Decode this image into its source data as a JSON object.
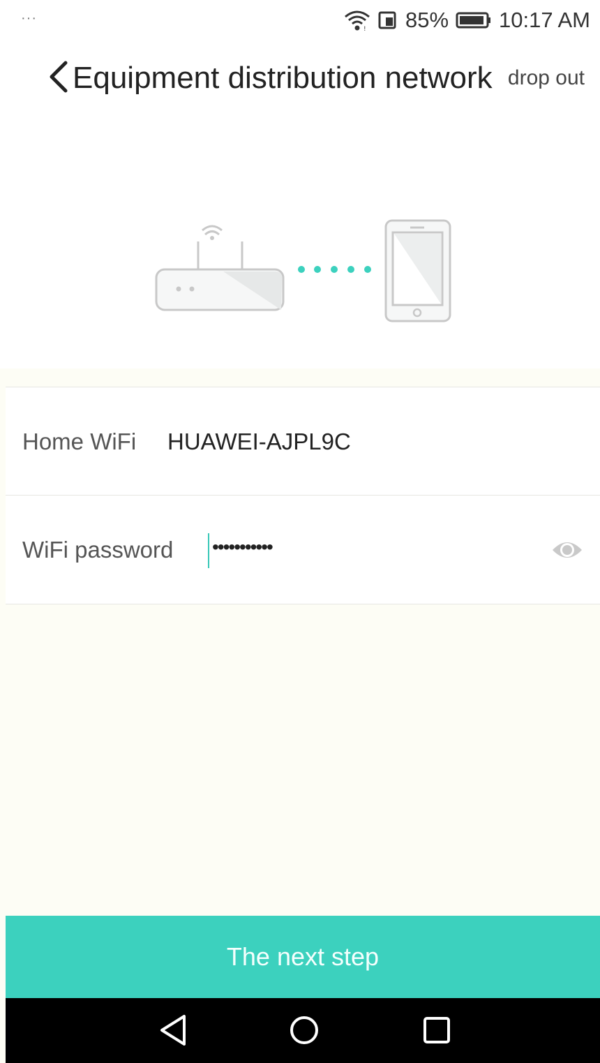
{
  "status_bar": {
    "more": "···",
    "battery_percent": "85%",
    "time": "10:17 AM"
  },
  "header": {
    "title": "Equipment distribution network",
    "drop_out": "drop out"
  },
  "illustration": {
    "router_icon": "router-icon",
    "phone_icon": "smartphone-icon",
    "accent_color": "#3cd1be"
  },
  "form": {
    "home_wifi_label": "Home WiFi",
    "home_wifi_value": "HUAWEI-AJPL9C",
    "password_label": "WiFi password",
    "password_value": "•••••••••••"
  },
  "next_button": {
    "label": "The next step"
  },
  "nav_bar": {
    "back_icon": "triangle-back-icon",
    "home_icon": "circle-home-icon",
    "recents_icon": "square-recents-icon"
  }
}
